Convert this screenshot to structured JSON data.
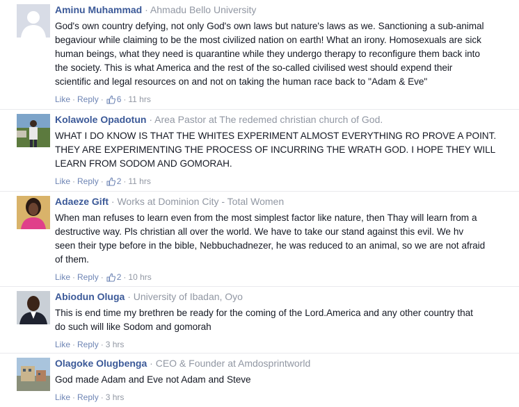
{
  "comments": [
    {
      "author": "Aminu Muhammad",
      "affiliation": "Ahmadu Bello University",
      "avatar": "default-avatar",
      "lines": [
        "God's own country defying, not only God's own laws but nature's laws as we. Sanctioning a sub-animal",
        "begaviour while claiming to be the most civilized nation on earth! What an irony. Homosexuals are sick",
        "human beings, what they need is quarantine while they undergo therapy to reconfigure them back into",
        "the society. This is what America and the rest of the so-called civilised west should expend their",
        "scientific and legal resources on and not on taking the human race back to \"Adam & Eve\""
      ],
      "like_label": "Like",
      "reply_label": "Reply",
      "likes": "6",
      "time": "11 hrs"
    },
    {
      "author": "Kolawole Opadotun",
      "affiliation": "Area Pastor at The redemed christian church of God.",
      "avatar": "man-outdoors-photo",
      "lines": [
        "WHAT I DO KNOW IS THAT THE WHITES EXPERIMENT ALMOST EVERYTHING RO PROVE A POINT.",
        "THEY ARE EXPERIMENTING THE PROCESS OF INCURRING THE WRATH GOD. I HOPE THEY WILL",
        "LEARN FROM SODOM AND GOMORAH."
      ],
      "like_label": "Like",
      "reply_label": "Reply",
      "likes": "2",
      "time": "11 hrs"
    },
    {
      "author": "Adaeze Gift",
      "affiliation": "Works at Dominion City - Total Women",
      "avatar": "woman-pink-photo",
      "lines": [
        "When man refuses to learn even from the most simplest factor like nature, then Thay will learn from a",
        "destructive way. Pls christian all over the world. We have to take our stand against this evil. We hv",
        "seen their type before in the bible, Nebbuchadnezer, he was reduced to an animal, so we are not afraid",
        "of them."
      ],
      "like_label": "Like",
      "reply_label": "Reply",
      "likes": "2",
      "time": "10 hrs"
    },
    {
      "author": "Abiodun Oluga",
      "affiliation": "University of Ibadan, Oyo",
      "avatar": "man-portrait-photo",
      "lines": [
        "This is end time my brethren be ready for the coming of the Lord.America and any other country that",
        "do such will like Sodom and gomorah"
      ],
      "like_label": "Like",
      "reply_label": "Reply",
      "likes": "",
      "time": "3 hrs"
    },
    {
      "author": "Olagoke Olugbenga",
      "affiliation": "CEO & Founder at Amdosprintworld",
      "avatar": "building-photo",
      "lines": [
        "God made Adam and Eve not Adam and Steve"
      ],
      "like_label": "Like",
      "reply_label": "Reply",
      "likes": "",
      "time": "3 hrs"
    }
  ]
}
